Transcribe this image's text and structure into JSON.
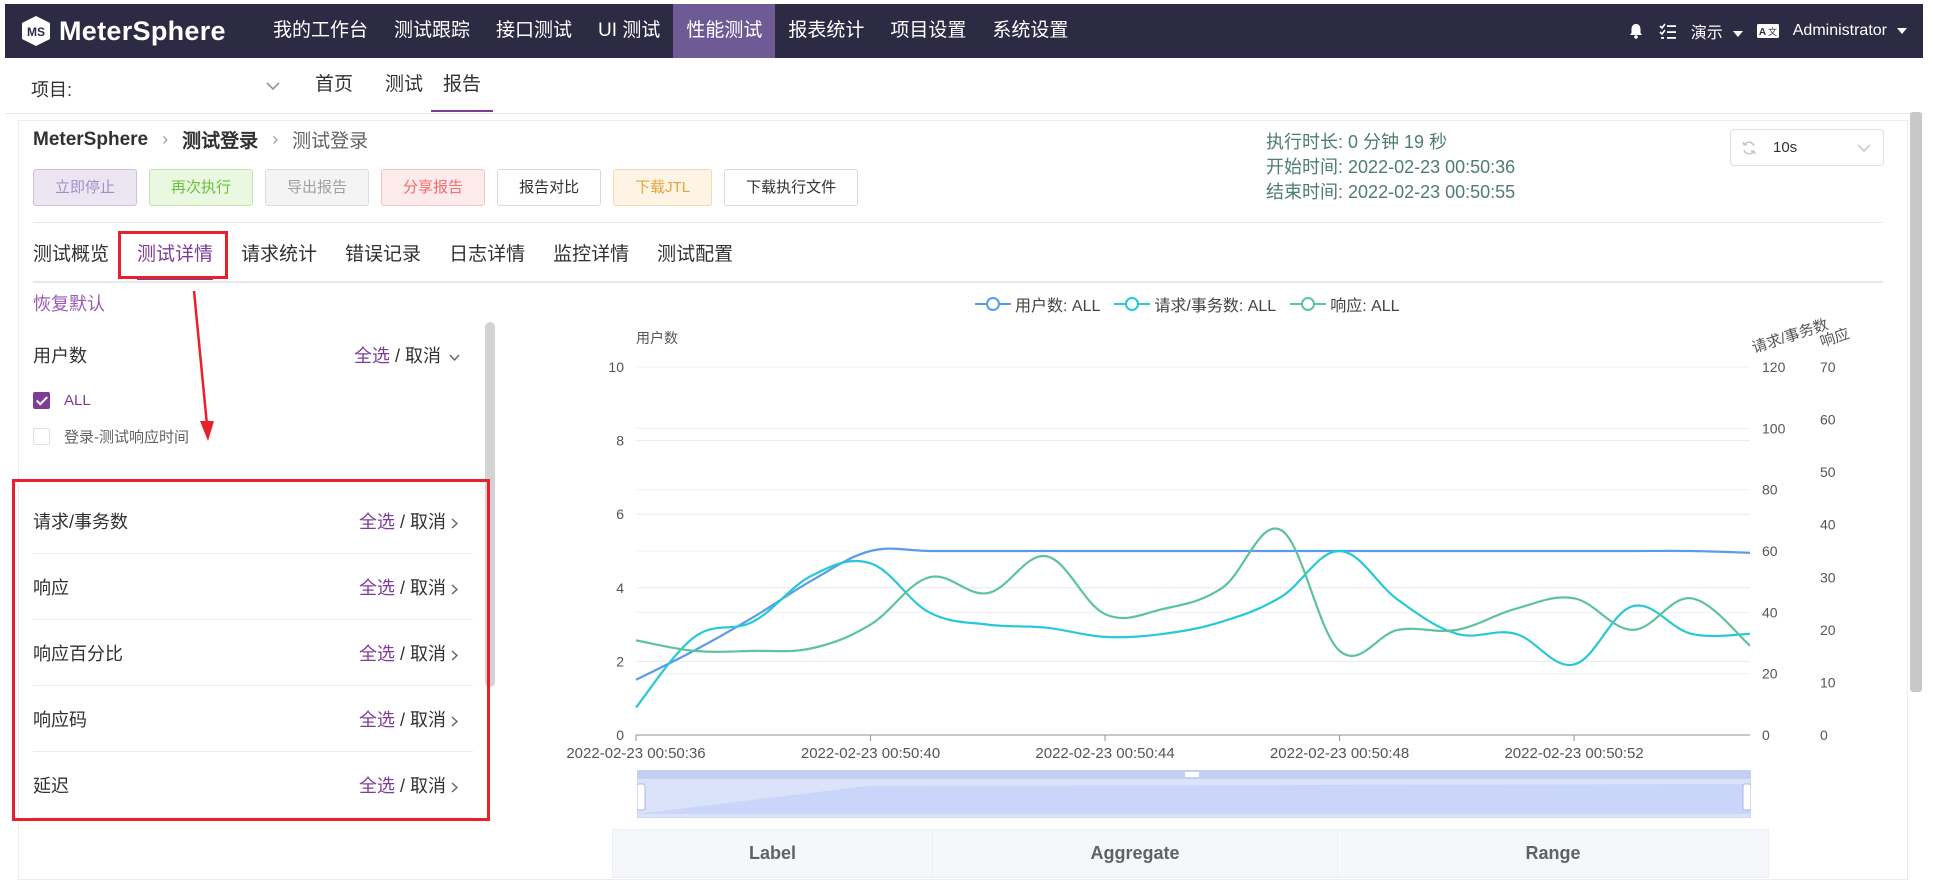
{
  "brand": {
    "name": "MeterSphere"
  },
  "topnav": {
    "items": [
      {
        "label": "我的工作台"
      },
      {
        "label": "测试跟踪"
      },
      {
        "label": "接口测试"
      },
      {
        "label": "UI 测试"
      },
      {
        "label": "性能测试",
        "active": true
      },
      {
        "label": "报表统计"
      },
      {
        "label": "项目设置"
      },
      {
        "label": "系统设置"
      }
    ],
    "workspace": "演示",
    "language_icon": "translate-icon",
    "user": "Administrator"
  },
  "subnav": {
    "project_label": "项目:",
    "tabs": [
      {
        "label": "首页"
      },
      {
        "label": "测试"
      },
      {
        "label": "报告",
        "active": true
      }
    ]
  },
  "report": {
    "breadcrumb": [
      "MeterSphere",
      "测试登录",
      "测试登录"
    ],
    "buttons": {
      "stop": "立即停止",
      "rerun": "再次执行",
      "export": "导出报告",
      "share": "分享报告",
      "compare": "报告对比",
      "download_jtl": "下载JTL",
      "download_files": "下载执行文件"
    },
    "duration_label": "执行时长:",
    "duration_value": "0 分钟 19 秒",
    "start_label": "开始时间:",
    "start_value": "2022-02-23 00:50:36",
    "end_label": "结束时间:",
    "end_value": "2022-02-23 00:50:55",
    "refresh_value": "10s"
  },
  "tabs": [
    {
      "label": "测试概览"
    },
    {
      "label": "测试详情",
      "active": true
    },
    {
      "label": "请求统计"
    },
    {
      "label": "错误记录"
    },
    {
      "label": "日志详情"
    },
    {
      "label": "监控详情"
    },
    {
      "label": "测试配置"
    }
  ],
  "restore_default": "恢复默认",
  "filters": {
    "select_all": "全选",
    "cancel": " / 取消",
    "groups": [
      {
        "label": "用户数",
        "expanded": true
      },
      {
        "label": "请求/事务数"
      },
      {
        "label": "响应"
      },
      {
        "label": "响应百分比"
      },
      {
        "label": "响应码"
      },
      {
        "label": "延迟"
      }
    ],
    "user_options": [
      {
        "label": "ALL",
        "checked": true
      },
      {
        "label": "登录-测试响应时间",
        "checked": false
      }
    ]
  },
  "chart_data": {
    "type": "line",
    "legend": [
      "用户数: ALL",
      "请求/事务数: ALL",
      "响应: ALL"
    ],
    "legend_position": "top-center",
    "x": [
      "2022-02-23 00:50:36",
      "2022-02-23 00:50:37",
      "2022-02-23 00:50:38",
      "2022-02-23 00:50:39",
      "2022-02-23 00:50:40",
      "2022-02-23 00:50:41",
      "2022-02-23 00:50:42",
      "2022-02-23 00:50:43",
      "2022-02-23 00:50:44",
      "2022-02-23 00:50:45",
      "2022-02-23 00:50:46",
      "2022-02-23 00:50:47",
      "2022-02-23 00:50:48",
      "2022-02-23 00:50:49",
      "2022-02-23 00:50:50",
      "2022-02-23 00:50:51",
      "2022-02-23 00:50:52",
      "2022-02-23 00:50:53",
      "2022-02-23 00:50:54",
      "2022-02-23 00:50:55"
    ],
    "x_tick_labels": [
      "2022-02-23 00:50:36",
      "2022-02-23 00:50:40",
      "2022-02-23 00:50:44",
      "2022-02-23 00:50:48",
      "2022-02-23 00:50:52"
    ],
    "series": [
      {
        "name": "用户数: ALL",
        "axis": "left",
        "color": "#5b9bea",
        "values": [
          1.5,
          2.3,
          3.2,
          4.2,
          5,
          5,
          5,
          5,
          5,
          5,
          5,
          5,
          5,
          5,
          5,
          5,
          5,
          5,
          5,
          4.95
        ]
      },
      {
        "name": "请求/事务数: ALL",
        "axis": "right1",
        "color": "#27c8d8",
        "values": [
          9,
          32,
          37,
          52,
          56,
          40,
          36,
          35,
          32,
          33,
          37,
          45,
          60,
          44,
          33,
          33,
          23,
          42,
          33,
          33
        ]
      },
      {
        "name": "响应: ALL",
        "axis": "right2",
        "color": "#5cc49a",
        "values": [
          18,
          16,
          16,
          16.5,
          21,
          30,
          27,
          34,
          23,
          24,
          28,
          39,
          16,
          20,
          20,
          24,
          26,
          20,
          26,
          17
        ]
      }
    ],
    "y_left": {
      "label": "用户数",
      "ticks": [
        0,
        2,
        4,
        6,
        8,
        10
      ],
      "range": [
        0,
        10
      ]
    },
    "y_right1": {
      "label": "请求/事务数",
      "ticks": [
        0,
        20,
        40,
        60,
        80,
        100,
        120
      ],
      "range": [
        0,
        120
      ]
    },
    "y_right2": {
      "label": "响应",
      "ticks": [
        0,
        10,
        20,
        30,
        40,
        50,
        60,
        70
      ],
      "range": [
        0,
        70
      ]
    },
    "grid": true
  },
  "table": {
    "headers": [
      "Label",
      "Aggregate",
      "Range"
    ]
  },
  "colors": {
    "nav_bg": "#2d2a43",
    "nav_active": "#6e5b96",
    "accent": "#7d3c98",
    "highlight": "#e8202a"
  }
}
